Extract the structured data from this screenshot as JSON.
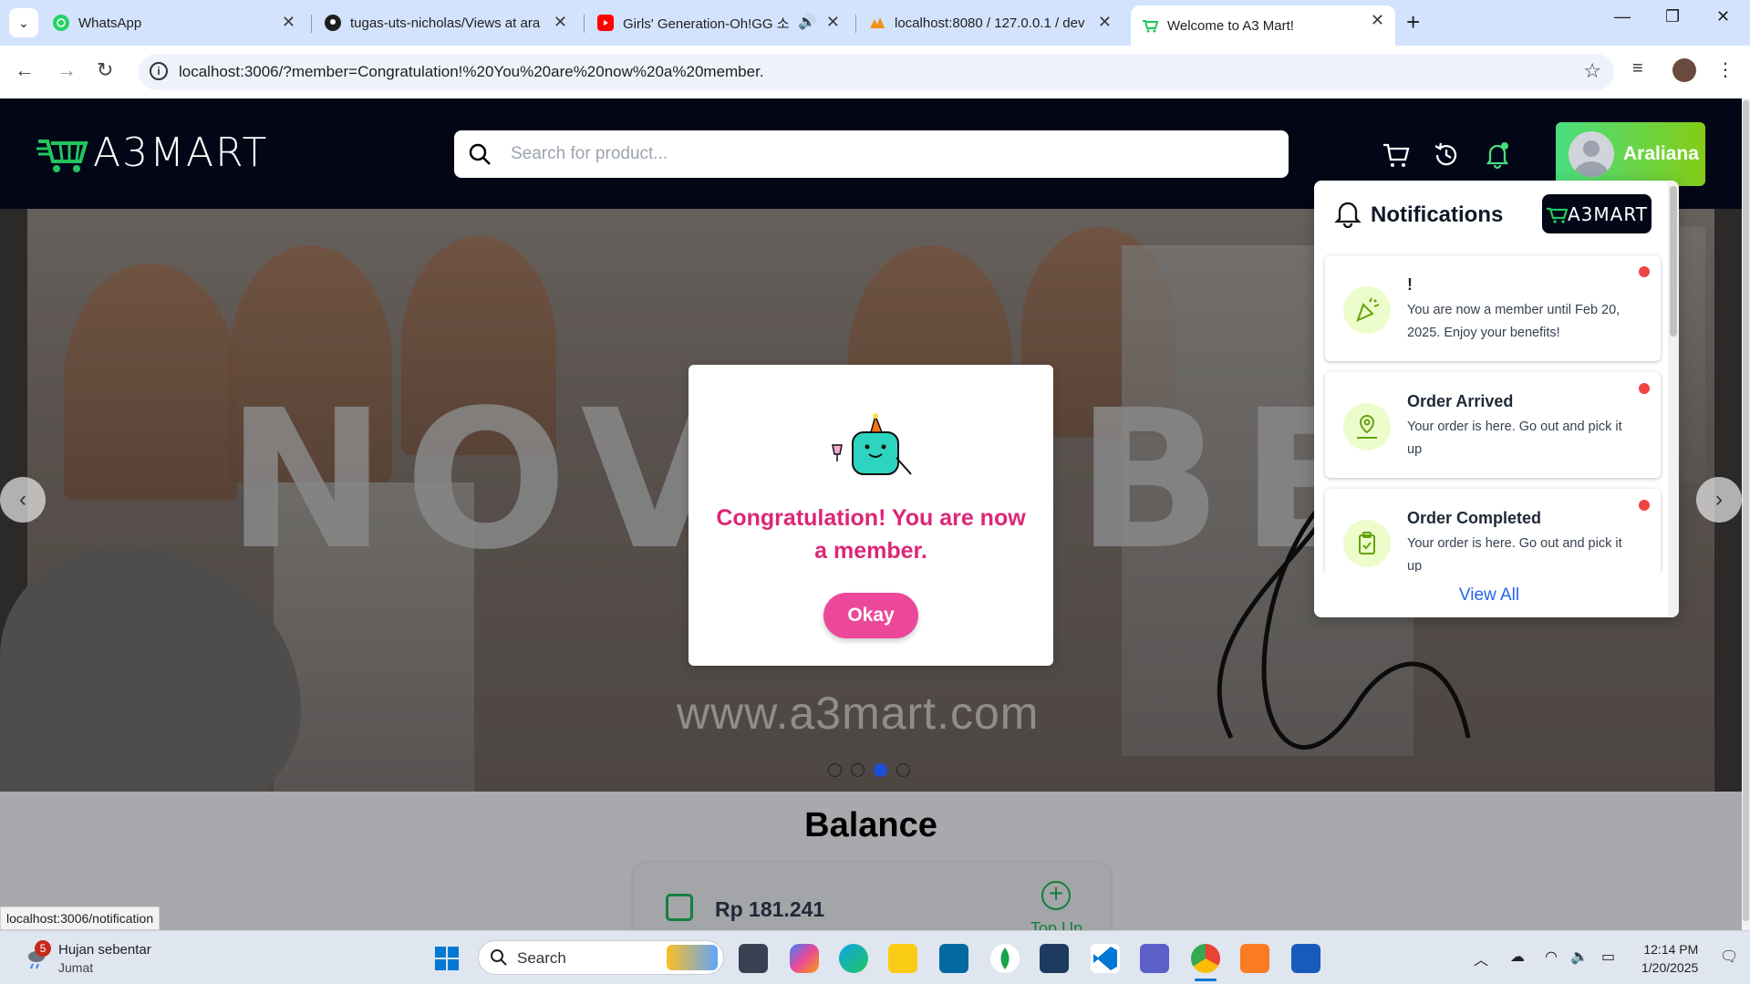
{
  "browser": {
    "tabs": [
      {
        "label": "WhatsApp",
        "icon": "whatsapp-icon"
      },
      {
        "label": "tugas-uts-nicholas/Views at ara",
        "icon": "github-icon"
      },
      {
        "label": "Girls' Generation-Oh!GG 소",
        "icon": "youtube-icon"
      },
      {
        "label": "localhost:8080 / 127.0.0.1 / dev",
        "icon": "phpmyadmin-icon"
      },
      {
        "label": "Welcome to A3 Mart!",
        "icon": "a3mart-favicon"
      }
    ],
    "url": "localhost:3006/?member=Congratulation!%20You%20are%20now%20a%20member."
  },
  "header": {
    "logo": "A3MART",
    "search_placeholder": "Search for product...",
    "username": "Araliana"
  },
  "banner": {
    "text_left": "NOV",
    "text_right": "BE",
    "url_text": "www.a3mart.com",
    "dots_count": 4,
    "active_dot": 3
  },
  "modal": {
    "message": "Congratulation! You are now a member.",
    "ok_label": "Okay"
  },
  "notifications": {
    "title": "Notifications",
    "logo": "A3MART",
    "items": [
      {
        "title": "!",
        "message": "You are now a member until Feb 20, 2025. Enjoy your benefits!",
        "icon": "party-popper-icon",
        "unread": true
      },
      {
        "title": "Order Arrived",
        "message": "Your order is here. Go out and pick it up",
        "icon": "location-person-icon",
        "unread": true
      },
      {
        "title": "Order Completed",
        "message": "Your order is here. Go out and pick it up",
        "icon": "clipboard-check-icon",
        "unread": true
      }
    ],
    "view_all": "View All"
  },
  "balance": {
    "title": "Balance",
    "amount": "Rp 181.241",
    "topup_label": "Top Up"
  },
  "status_link": "localhost:3006/notification",
  "taskbar": {
    "weather_badge": "5",
    "weather_line1": "Hujan sebentar",
    "weather_line2": "Jumat",
    "search_label": "Search",
    "time": "12:14 PM",
    "date": "1/20/2025"
  },
  "colors": {
    "header_bg": "#020617",
    "accent_green": "#4ade80",
    "modal_pink": "#db2777",
    "button_pink": "#ec4899",
    "link_blue": "#2563eb",
    "unread_red": "#ef4444"
  }
}
